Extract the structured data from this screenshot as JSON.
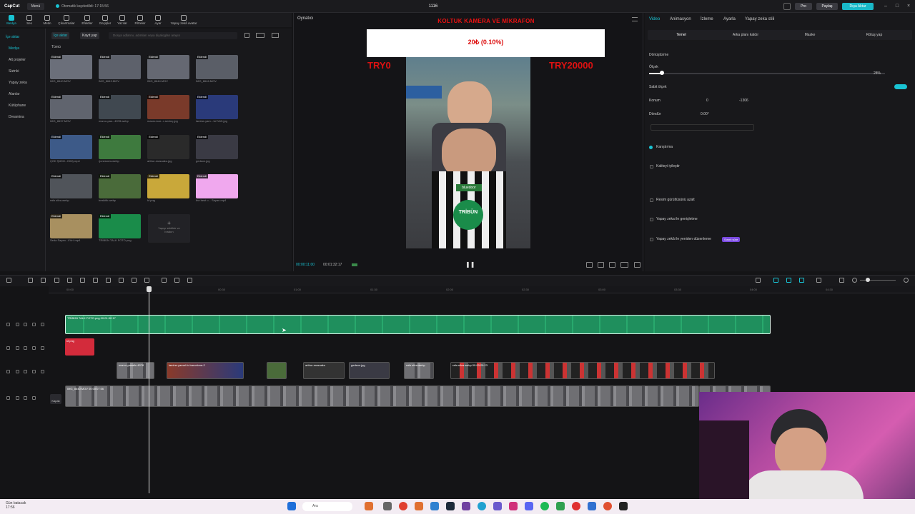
{
  "app": {
    "logo": "CapCut",
    "menu": "Menü",
    "autosave": "Otomatik kaydedildi: 17:15:56",
    "title": "1116",
    "pro": "Pro",
    "share": "Paylaş",
    "export": "Dışa Aktar"
  },
  "toolbar": [
    "Medya",
    "Ses",
    "Metin",
    "Çıkartmalar",
    "Efektler",
    "Geçişler",
    "Yazılar",
    "Filtreler",
    "Ayar",
    "Yapay zekâ avatar"
  ],
  "sidebar": [
    "İçe aktar",
    "Medya",
    "Alt projeler",
    "Sizinki",
    "Yapay zeka",
    "Alanlar",
    "Kütüphane",
    "Dreamina"
  ],
  "media": {
    "import": "İçe aktar",
    "record": "Kayıt yap",
    "search_placeholder": "Dosya adlarını, adımları veya diyalogları arayın",
    "category": "Tümü",
    "badge": "Eklendi",
    "import_tile": "Yapıyı sürükle ve bırakın",
    "items": [
      {
        "name": "IMG_8640.MOV",
        "color": "#6b6f7a"
      },
      {
        "name": "IMG_8643.MOV",
        "color": "#5d616b"
      },
      {
        "name": "IMG_8644.MOV",
        "color": "#656872"
      },
      {
        "name": "IMG_8646.MOV",
        "color": "#5a5e67"
      },
      {
        "name": "IMG_8637.MOV",
        "color": "#60646e"
      },
      {
        "name": "marco-pas...4578.webp",
        "color": "#404850"
      },
      {
        "name": "mauro-icar...r-sevinç.jpg",
        "color": "#7a3a2a"
      },
      {
        "name": "lamine-yam...1e7d15.jpg",
        "color": "#2a3a7a"
      },
      {
        "name": "ÇOK ŞÜKÜ...DIM).mp4",
        "color": "#3d5a88"
      },
      {
        "name": "rjonesnew.webp",
        "color": "#3e7a3e"
      },
      {
        "name": "arthur-masuaku.jpg",
        "color": "#2a2a2a"
      },
      {
        "name": "gedson.jpg",
        "color": "#3a3a44"
      },
      {
        "name": "rafa silva.webp",
        "color": "#50545a"
      },
      {
        "name": "besiktik.webp",
        "color": "#4a6b3a"
      },
      {
        "name": "kf.png",
        "color": "#c9a83a"
      },
      {
        "name": "the best o... Sayan.mp4",
        "color": "#f0a8ee"
      },
      {
        "name": "Seda Sayan...ü'ün'.mp4",
        "color": "#a89060"
      },
      {
        "name": "TRİBÜN TALK FOTO.png",
        "color": "#1a8c4a"
      }
    ]
  },
  "player": {
    "label": "Oynatıcı",
    "banner": "KOLTUK KAMERA VE MİKRAFON",
    "price": "20₺ (0.10%)",
    "left": "TRY0",
    "right": "TRY20000",
    "logo": "TRİBÜN",
    "time_current": "00:00:11:00",
    "time_total": "00:01:32:17"
  },
  "props": {
    "tabs": [
      "Video",
      "Animasyon",
      "İzleme",
      "Ayarla",
      "Yapay zeka stili"
    ],
    "subtabs": [
      "Temel",
      "Arka planı kaldır",
      "Maske",
      "Rötuş yap"
    ],
    "transform": "Dönüştürme",
    "scale": "Ölçek",
    "scale_value": "28%",
    "uniform": "Sabit ölçek",
    "position": "Konum",
    "pos_x": "0",
    "pos_y": "-1306",
    "rotate": "Döndür",
    "rotate_value": "0.00°",
    "blend": "Karıştırma",
    "enhance": "Kaliteyi iyileştir",
    "denoise": "Resim gürültüsünü azalt",
    "expand": "Yapay zeka ile genişletme",
    "relight": "Yapay zekâ ile yeniden düzenleme",
    "relight_badge": "Sınırlı süre"
  },
  "timeline": {
    "ticks": [
      "00:00",
      "00:30",
      "01:00",
      "01:30",
      "02:00",
      "02:30",
      "03:00",
      "03:30",
      "04:00",
      "04:30"
    ],
    "cover": "Kapak",
    "green_clip": "TRİBÜN TALK FOTO.png  00:01:32:17",
    "kf_clip": "kf.png",
    "overlays": [
      "marco-pasalic-4578",
      "lamine-yamal-fc-barcelona-2",
      "gedson.jpg",
      "arthur-masuaku",
      "rafa silva.webp",
      "rafa silva.webp   00:00:29:23"
    ],
    "main": "IMG_8640.MOV  00:00:07:06"
  },
  "taskbar": {
    "weather": "Gün batacak",
    "weather_time": "17:56",
    "search": "Ara"
  }
}
